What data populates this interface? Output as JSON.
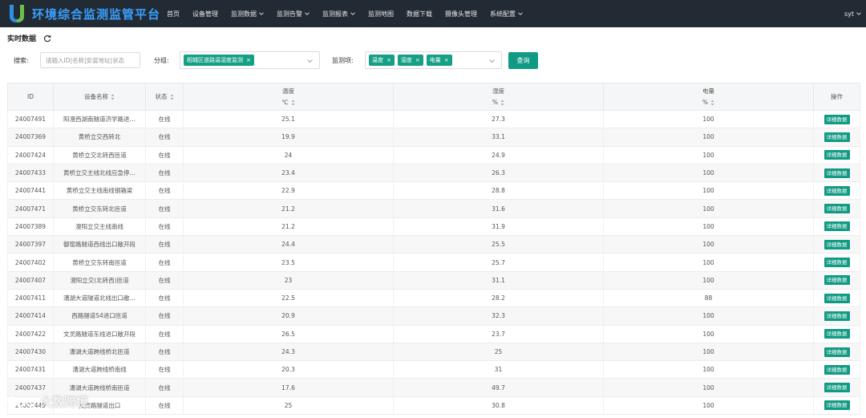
{
  "app": {
    "title": "环境综合监测监管平台"
  },
  "nav": {
    "items": [
      {
        "label": "首页",
        "dropdown": false
      },
      {
        "label": "设备管理",
        "dropdown": false
      },
      {
        "label": "监测数据",
        "dropdown": true
      },
      {
        "label": "监测告警",
        "dropdown": true
      },
      {
        "label": "监测报表",
        "dropdown": true
      },
      {
        "label": "监测地图",
        "dropdown": false
      },
      {
        "label": "数据下载",
        "dropdown": false
      },
      {
        "label": "摄像头管理",
        "dropdown": false
      },
      {
        "label": "系统配置",
        "dropdown": true
      }
    ],
    "user": "syt"
  },
  "page": {
    "title": "实时数据"
  },
  "filters": {
    "search_label": "搜索:",
    "search_placeholder": "请输入ID|名称|安装地址|状态",
    "group_label": "分组:",
    "group_tags": [
      "相城区道路温湿度监测"
    ],
    "monitor_label": "监测项:",
    "monitor_tags": [
      "温度",
      "湿度",
      "电量"
    ],
    "query_button": "查询"
  },
  "table": {
    "headers": {
      "id": "ID",
      "name": "设备名称",
      "status": "状态",
      "temp": "温度",
      "temp_unit": "℃",
      "humidity": "湿度",
      "humidity_unit": "%",
      "battery": "电量",
      "battery_unit": "%",
      "action": "操作"
    },
    "detail_button": "详细数据",
    "rows": [
      {
        "id": "24007491",
        "name": "阳澄西湖南隧道济学路进…",
        "status": "在线",
        "temp": "25.1",
        "humidity": "27.3",
        "battery": "100"
      },
      {
        "id": "24007369",
        "name": "黄桥立交西转北",
        "status": "在线",
        "temp": "19.9",
        "humidity": "33.1",
        "battery": "100"
      },
      {
        "id": "24007424",
        "name": "黄桥立交北转西匝道",
        "status": "在线",
        "temp": "24",
        "humidity": "24.9",
        "battery": "100"
      },
      {
        "id": "24007433",
        "name": "黄桥立交主线北线应急停…",
        "status": "在线",
        "temp": "23.4",
        "humidity": "26.3",
        "battery": "100"
      },
      {
        "id": "24007441",
        "name": "黄桥立交主线南线钢箱梁",
        "status": "在线",
        "temp": "22.9",
        "humidity": "28.8",
        "battery": "100"
      },
      {
        "id": "24007471",
        "name": "黄桥立交东转北匝道",
        "status": "在线",
        "temp": "21.2",
        "humidity": "31.6",
        "battery": "100"
      },
      {
        "id": "24007389",
        "name": "澄阳立交主线南线",
        "status": "在线",
        "temp": "21.2",
        "humidity": "31.9",
        "battery": "100"
      },
      {
        "id": "24007397",
        "name": "御窑路隧道西线出口敞开段",
        "status": "在线",
        "temp": "24.4",
        "humidity": "25.5",
        "battery": "100"
      },
      {
        "id": "24007402",
        "name": "黄桥立交东转南匝道",
        "status": "在线",
        "temp": "23.5",
        "humidity": "25.7",
        "battery": "100"
      },
      {
        "id": "24007407",
        "name": "澄阳立交(北转西)匝道",
        "status": "在线",
        "temp": "23",
        "humidity": "31.1",
        "battery": "100"
      },
      {
        "id": "24007411",
        "name": "漕湖大道隧道北线出口敞…",
        "status": "在线",
        "temp": "22.5",
        "humidity": "28.2",
        "battery": "88"
      },
      {
        "id": "24007414",
        "name": "西路隧道S4进口匝道",
        "status": "在线",
        "temp": "20.9",
        "humidity": "32.3",
        "battery": "100"
      },
      {
        "id": "24007422",
        "name": "文灵路隧道东线进口敞开段",
        "status": "在线",
        "temp": "26.5",
        "humidity": "23.7",
        "battery": "100"
      },
      {
        "id": "24007430",
        "name": "漕湖大道跨线桥北匝道",
        "status": "在线",
        "temp": "24.3",
        "humidity": "25",
        "battery": "100"
      },
      {
        "id": "24007431",
        "name": "漕湖大道跨线桥南线",
        "status": "在线",
        "temp": "20.3",
        "humidity": "31",
        "battery": "100"
      },
      {
        "id": "24007437",
        "name": "漕湖大道跨线桥南匝道",
        "status": "在线",
        "temp": "17.6",
        "humidity": "49.7",
        "battery": "100"
      },
      {
        "id": "24007449",
        "name": "文灵路隧道出口",
        "status": "在线",
        "temp": "25",
        "humidity": "30.8",
        "battery": "100"
      }
    ]
  },
  "watermark": {
    "text": "大数跨境"
  },
  "colors": {
    "topbar": "#222a33",
    "accent": "#119a83",
    "title": "#3aa0ff"
  }
}
